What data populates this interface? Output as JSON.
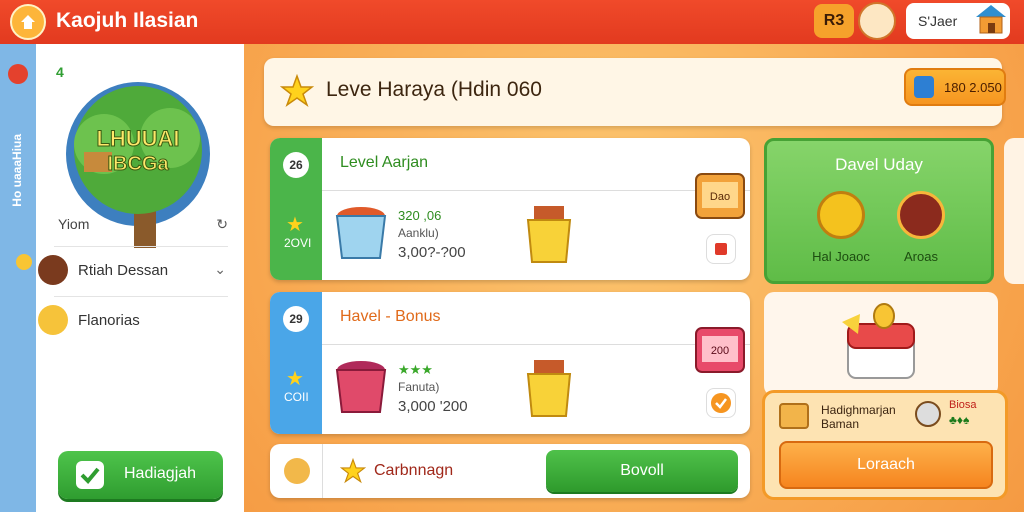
{
  "app": {
    "title": "Kaojuh Ilasian"
  },
  "topbar": {
    "coin_value": "R3",
    "user_label": "S'Jaer"
  },
  "sidebar": {
    "level": "4",
    "vertical_text": "Ho uaaaHiua",
    "tree_text_1": "LHUUAI",
    "tree_text_2": "IBCGa",
    "first_item": "Yiom",
    "items": [
      {
        "label": "Rtiah Dessan"
      },
      {
        "label": "Flanorias"
      }
    ],
    "claim_label": "Hadiagjah"
  },
  "header": {
    "title": "Leve Haraya (Hdin 060",
    "chip_value": "180 2.050"
  },
  "levels": [
    {
      "number": "26",
      "name": "Level Aarjan",
      "side_label": "2OVI",
      "line1": "320 ,06",
      "line2": "Aanklu)",
      "line3": "3,00?-?00",
      "gift_text": "Dao"
    },
    {
      "number": "29",
      "name": "Havel - Bonus",
      "side_label": "COII",
      "line1": "★★★",
      "line2": "Fanuta)",
      "line3": "3,000 '200",
      "gift_text": "200"
    }
  ],
  "bottom_bar": {
    "label": "Carbnnagn",
    "button": "Bovoll"
  },
  "daily": {
    "title": "Davel Uday",
    "reward1": "Hal Joaoc",
    "reward2": "Aroas"
  },
  "offer": {
    "title1": "Hadighmarjan",
    "title2": "Baman",
    "tag1": "Biosa",
    "tag2": "♣♦♠",
    "button": "Loraach"
  },
  "colors": {
    "green": "#4ec44b",
    "orange": "#f69520",
    "red": "#e23a1f",
    "blue": "#4aa6e8"
  }
}
